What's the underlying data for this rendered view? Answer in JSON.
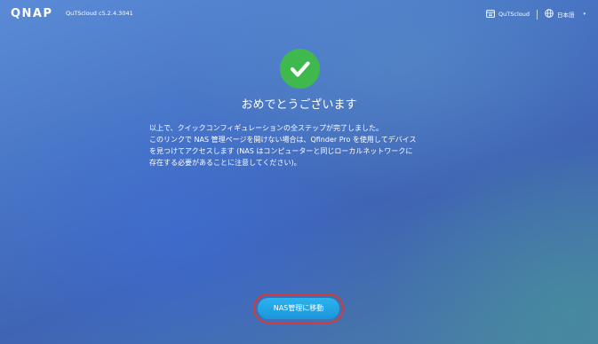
{
  "header": {
    "logo": "QNAP",
    "version": "QuTScloud c5.2.4.3041",
    "product_link": "QuTScloud",
    "language": "日本語",
    "icons": [
      "quts-cloud-icon",
      "globe-icon",
      "chevron-down-icon"
    ]
  },
  "main": {
    "status_icon": "checkmark-icon",
    "status_color": "#3fb84e",
    "title": "おめでとうございます",
    "message_lines": [
      "以上で、クイックコンフィギュレーションの全ステップが完了しました。",
      "このリンクで NAS 管理ページを開けない場合は、Qfinder Pro を使用してデバイス",
      "を見つけてアクセスします (NAS はコンピューターと同じローカルネットワークに",
      "存在する必要があることに注意してください)。"
    ]
  },
  "footer": {
    "primary_button_label": "NAS管理に移動",
    "button_color": "#1fa3e4",
    "focus_ring_color": "#d23b3b"
  }
}
